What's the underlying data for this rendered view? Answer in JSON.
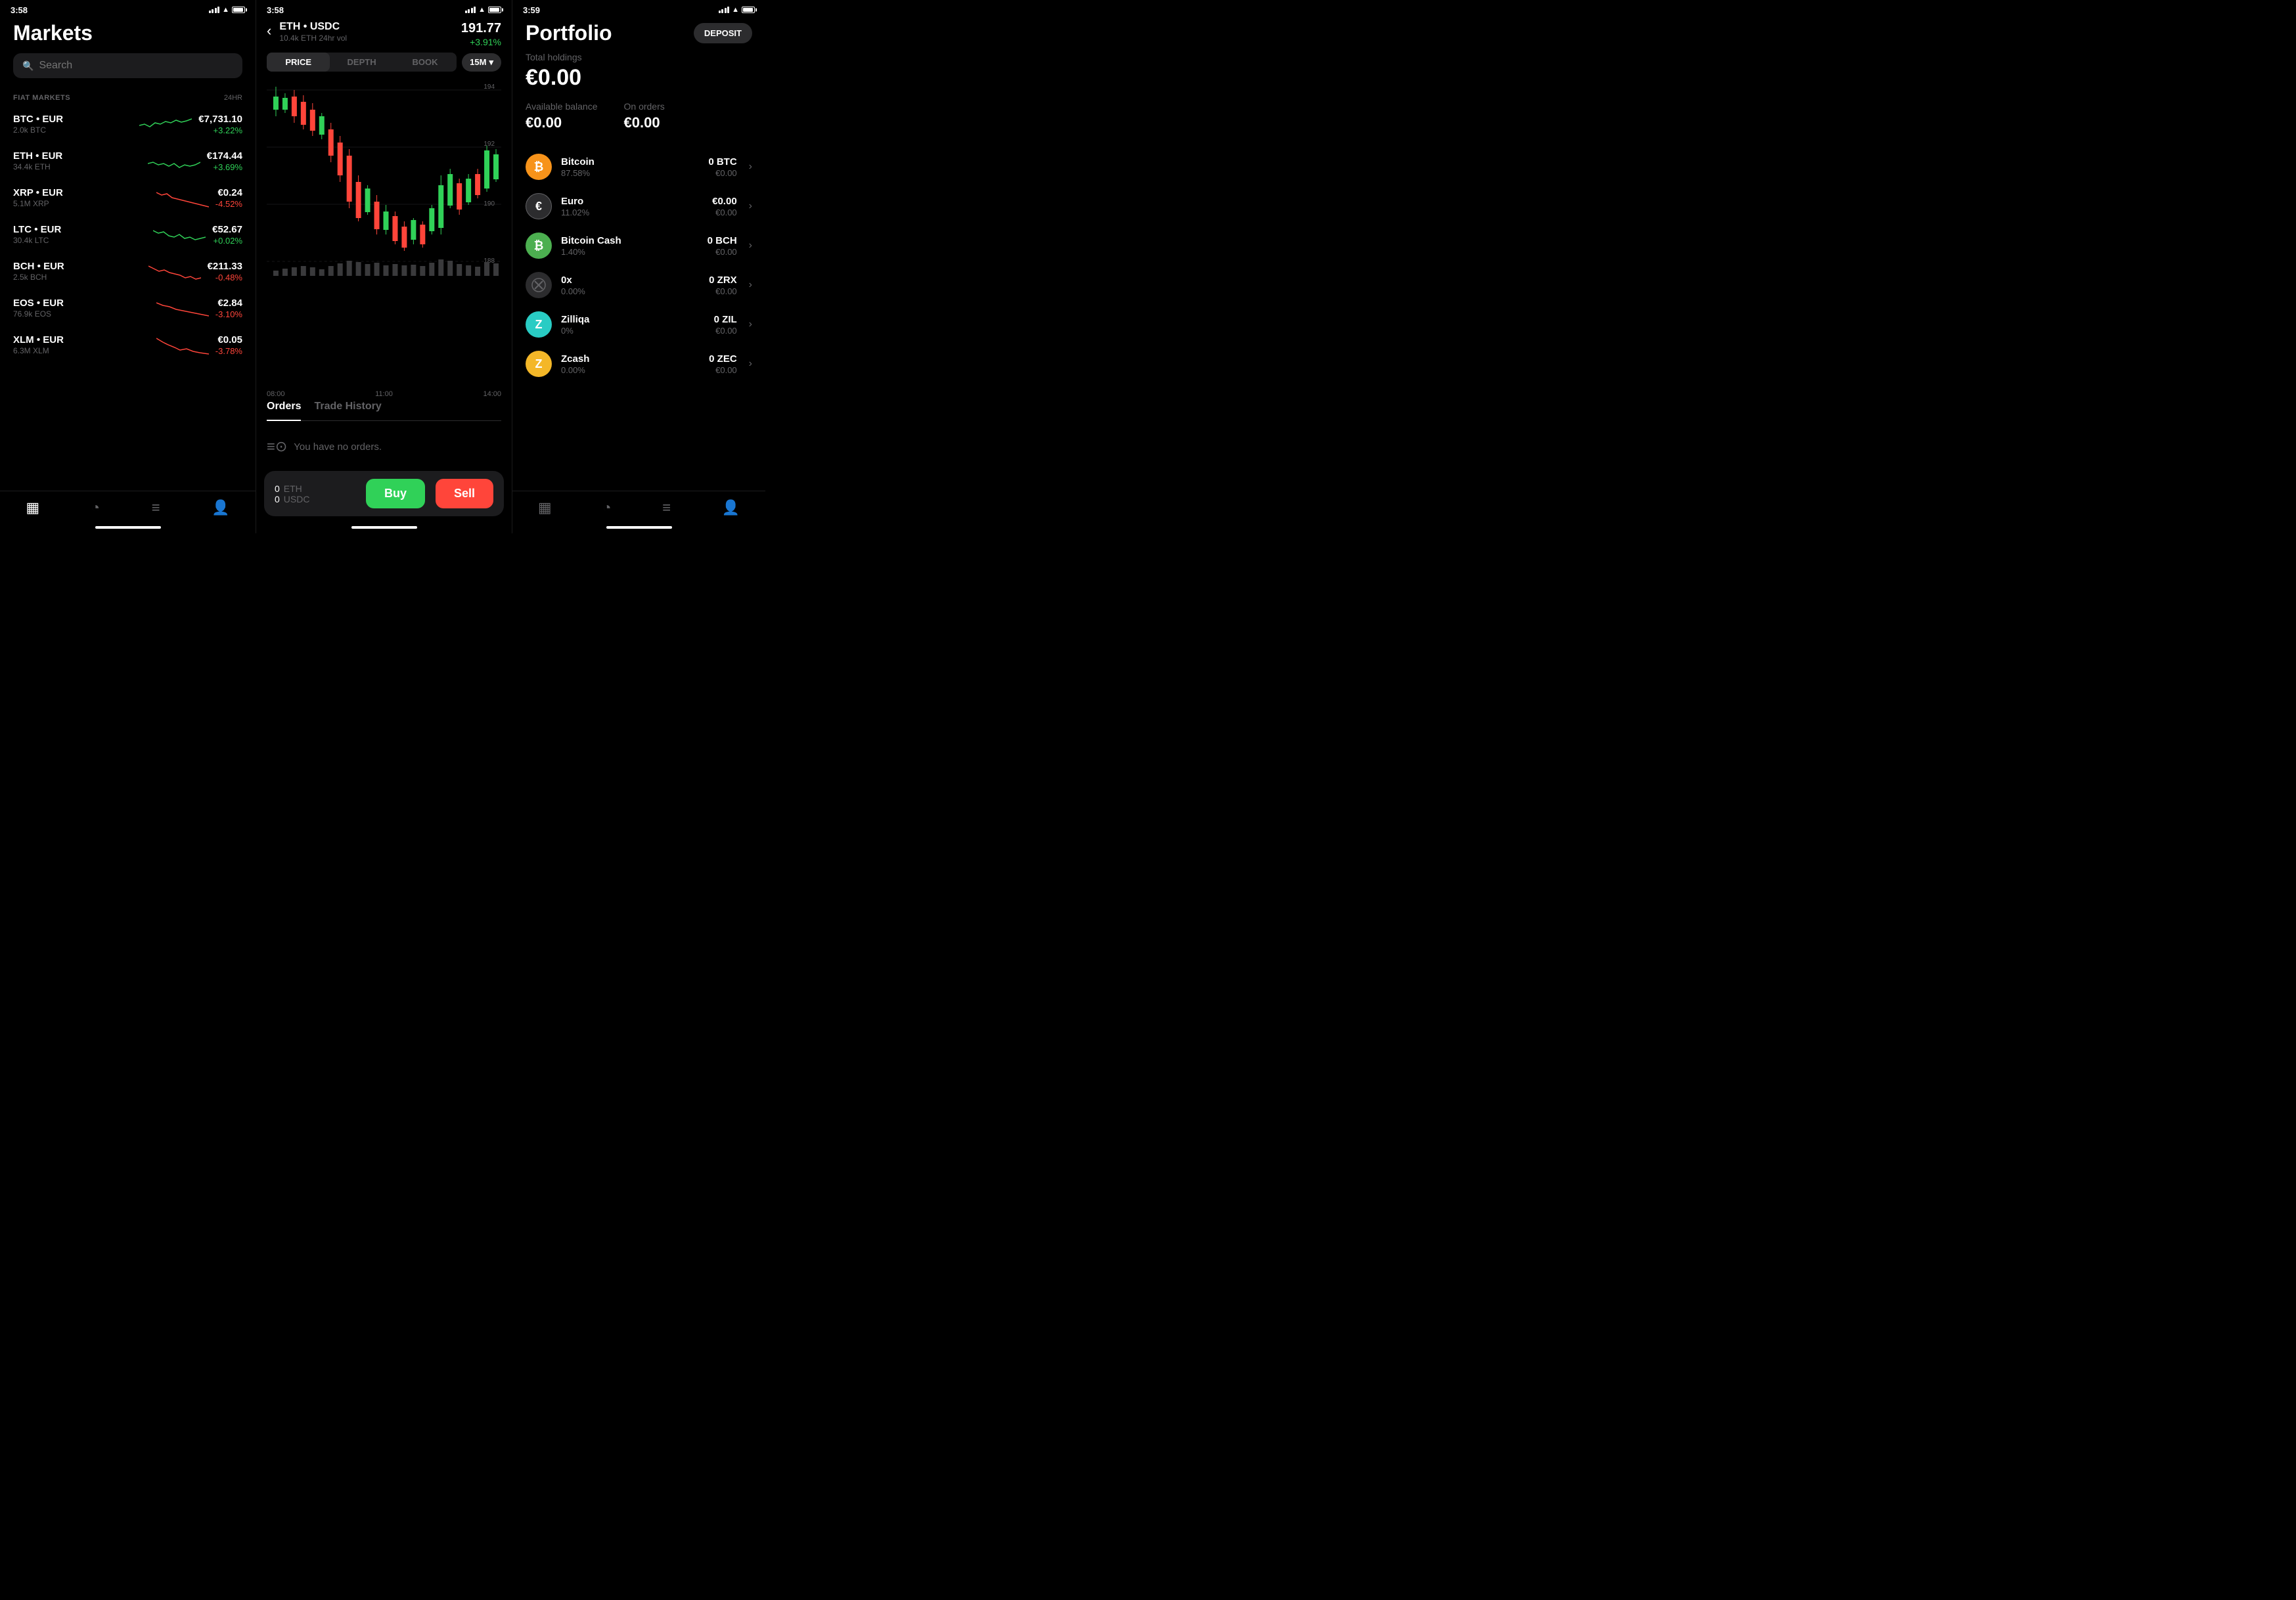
{
  "panel1": {
    "status": {
      "time": "3:58",
      "location": true
    },
    "title": "Markets",
    "search": {
      "placeholder": "Search"
    },
    "section": {
      "label": "FIAT MARKETS",
      "col": "24HR"
    },
    "markets": [
      {
        "pair": "BTC • EUR",
        "volume": "2.0k BTC",
        "price": "€7,731.10",
        "change": "+3.22%",
        "positive": true
      },
      {
        "pair": "ETH • EUR",
        "volume": "34.4k ETH",
        "price": "€174.44",
        "change": "+3.69%",
        "positive": true
      },
      {
        "pair": "XRP • EUR",
        "volume": "5.1M XRP",
        "price": "€0.24",
        "change": "-4.52%",
        "positive": false
      },
      {
        "pair": "LTC • EUR",
        "volume": "30.4k LTC",
        "price": "€52.67",
        "change": "+0.02%",
        "positive": true
      },
      {
        "pair": "BCH • EUR",
        "volume": "2.5k BCH",
        "price": "€211.33",
        "change": "-0.48%",
        "positive": false
      },
      {
        "pair": "EOS • EUR",
        "volume": "76.9k EOS",
        "price": "€2.84",
        "change": "-3.10%",
        "positive": false
      },
      {
        "pair": "XLM • EUR",
        "volume": "6.3M XLM",
        "price": "€0.05",
        "change": "-3.78%",
        "positive": false
      }
    ],
    "nav": [
      "markets",
      "portfolio",
      "orders",
      "account"
    ]
  },
  "panel2": {
    "status": {
      "time": "3:58"
    },
    "header": {
      "pair": "ETH • USDC",
      "volume": "10.4k ETH 24hr vol",
      "price": "191.77",
      "change": "+3.91%"
    },
    "tabs": [
      "PRICE",
      "DEPTH",
      "BOOK"
    ],
    "active_tab": "PRICE",
    "timeframe": "15M",
    "chart_levels": [
      "194",
      "192",
      "190",
      "188"
    ],
    "xaxis": [
      "08:00",
      "11:00",
      "14:00"
    ],
    "orders_tabs": [
      "Orders",
      "Trade History"
    ],
    "no_orders": "You have no orders.",
    "trade": {
      "eth_balance": "0",
      "eth_label": "ETH",
      "usdc_balance": "0",
      "usdc_label": "USDC",
      "buy_label": "Buy",
      "sell_label": "Sell"
    }
  },
  "panel3": {
    "status": {
      "time": "3:59"
    },
    "title": "Portfolio",
    "deposit_label": "DEPOSIT",
    "total_holdings_label": "Total holdings",
    "total_holdings_value": "€0.00",
    "available_balance_label": "Available balance",
    "available_balance_value": "€0.00",
    "on_orders_label": "On orders",
    "on_orders_value": "€0.00",
    "assets": [
      {
        "name": "Bitcoin",
        "pct": "87.58%",
        "amount": "0 BTC",
        "eur": "€0.00",
        "icon": "btc",
        "symbol": "₿"
      },
      {
        "name": "Euro",
        "pct": "11.02%",
        "amount": "€0.00",
        "eur": "€0.00",
        "icon": "eur",
        "symbol": "€"
      },
      {
        "name": "Bitcoin Cash",
        "pct": "1.40%",
        "amount": "0 BCH",
        "eur": "€0.00",
        "icon": "bch",
        "symbol": "₿"
      },
      {
        "name": "0x",
        "pct": "0.00%",
        "amount": "0 ZRX",
        "eur": "€0.00",
        "icon": "zrx",
        "symbol": "✕"
      },
      {
        "name": "Zilliqa",
        "pct": "0%",
        "amount": "0 ZIL",
        "eur": "€0.00",
        "icon": "zil",
        "symbol": "Z"
      },
      {
        "name": "Zcash",
        "pct": "0.00%",
        "amount": "0 ZEC",
        "eur": "€0.00",
        "icon": "zec",
        "symbol": "Z"
      }
    ],
    "nav": [
      "markets",
      "portfolio",
      "orders",
      "account"
    ]
  }
}
